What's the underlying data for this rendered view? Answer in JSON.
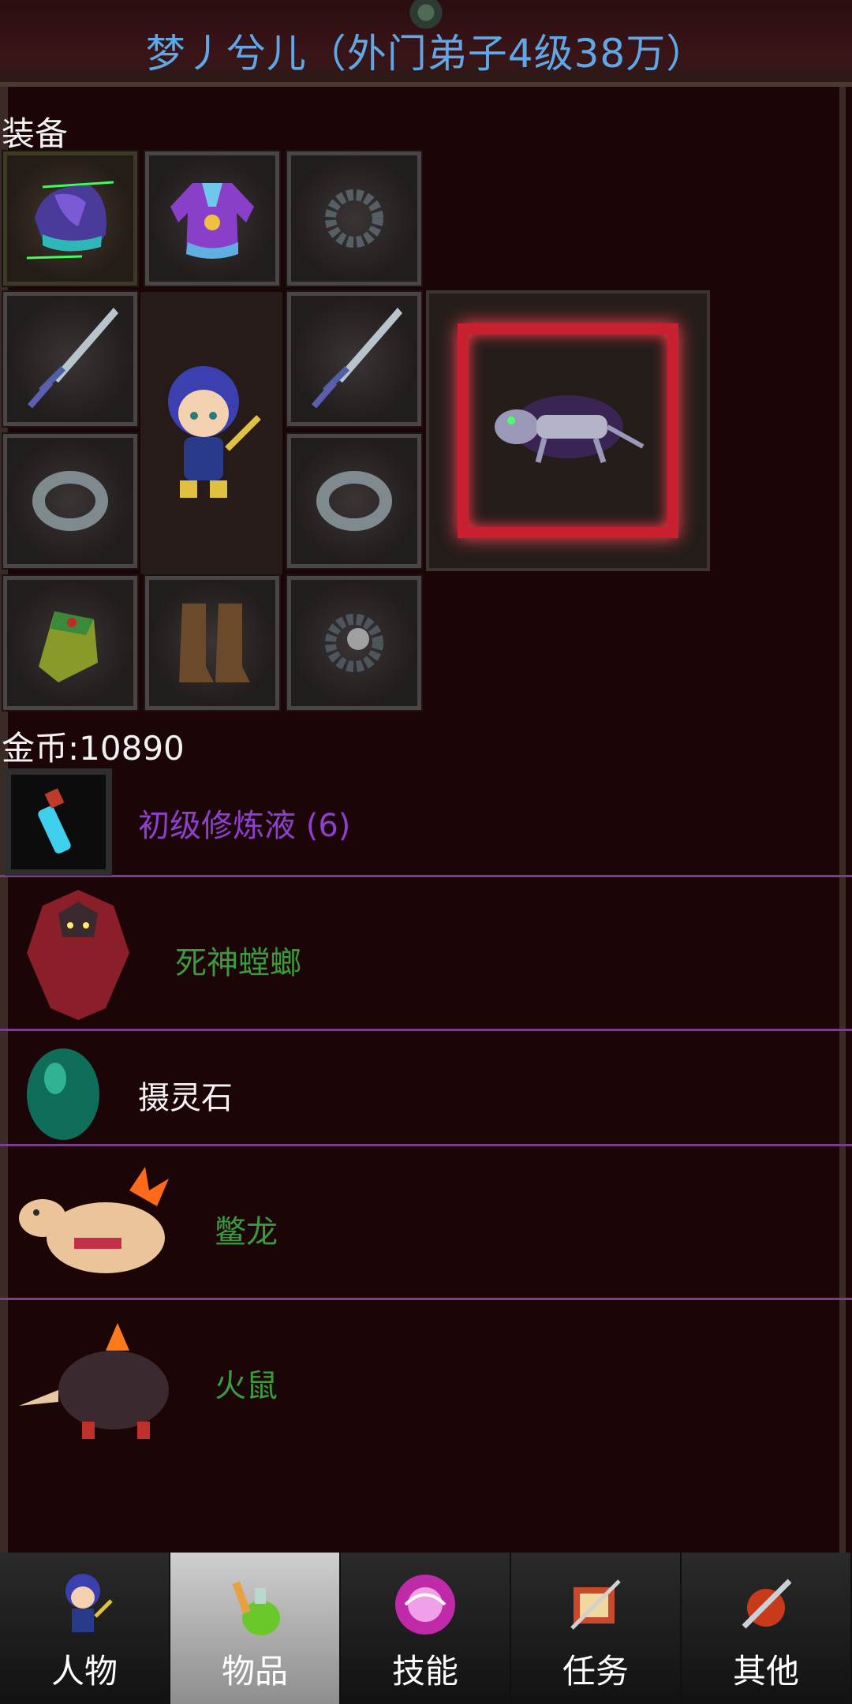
{
  "title": "梦丿兮儿（外门弟子4级38万）",
  "equipment": {
    "label": "装备",
    "slots": [
      "helmet-icon",
      "armor-icon",
      "necklace-icon",
      "sword-icon",
      "sword-icon",
      "ring-icon",
      "ring-icon",
      "bracer-icon",
      "boots-icon",
      "bead-icon"
    ],
    "hero": "hero-avatar-icon",
    "pet": "skeleton-lizard-pet-icon"
  },
  "gold": {
    "label": "金币:10890"
  },
  "items": [
    {
      "name": "初级修炼液 (6)",
      "icon": "potion-vial-icon",
      "color": "#8e3fd0"
    },
    {
      "name": "死神螳螂",
      "icon": "mantis-icon",
      "color": "#3b9a3b"
    },
    {
      "name": "摄灵石",
      "icon": "spirit-stone-icon",
      "color": "#f2f2f2"
    },
    {
      "name": "鳖龙",
      "icon": "fire-lizard-icon",
      "color": "#3b9a3b"
    },
    {
      "name": "火鼠",
      "icon": "fire-mouse-icon",
      "color": "#3b9a3b"
    }
  ],
  "nav": [
    {
      "label": "人物",
      "icon": "character-icon",
      "active": false
    },
    {
      "label": "物品",
      "icon": "items-potion-icon",
      "active": true
    },
    {
      "label": "技能",
      "icon": "skill-orb-icon",
      "active": false
    },
    {
      "label": "任务",
      "icon": "quest-icon",
      "active": false
    },
    {
      "label": "其他",
      "icon": "other-sword-icon",
      "active": false
    }
  ],
  "colors": {
    "accent_title": "#5fa8e8",
    "divider": "#7a3f8a",
    "background": "#1c0507"
  }
}
